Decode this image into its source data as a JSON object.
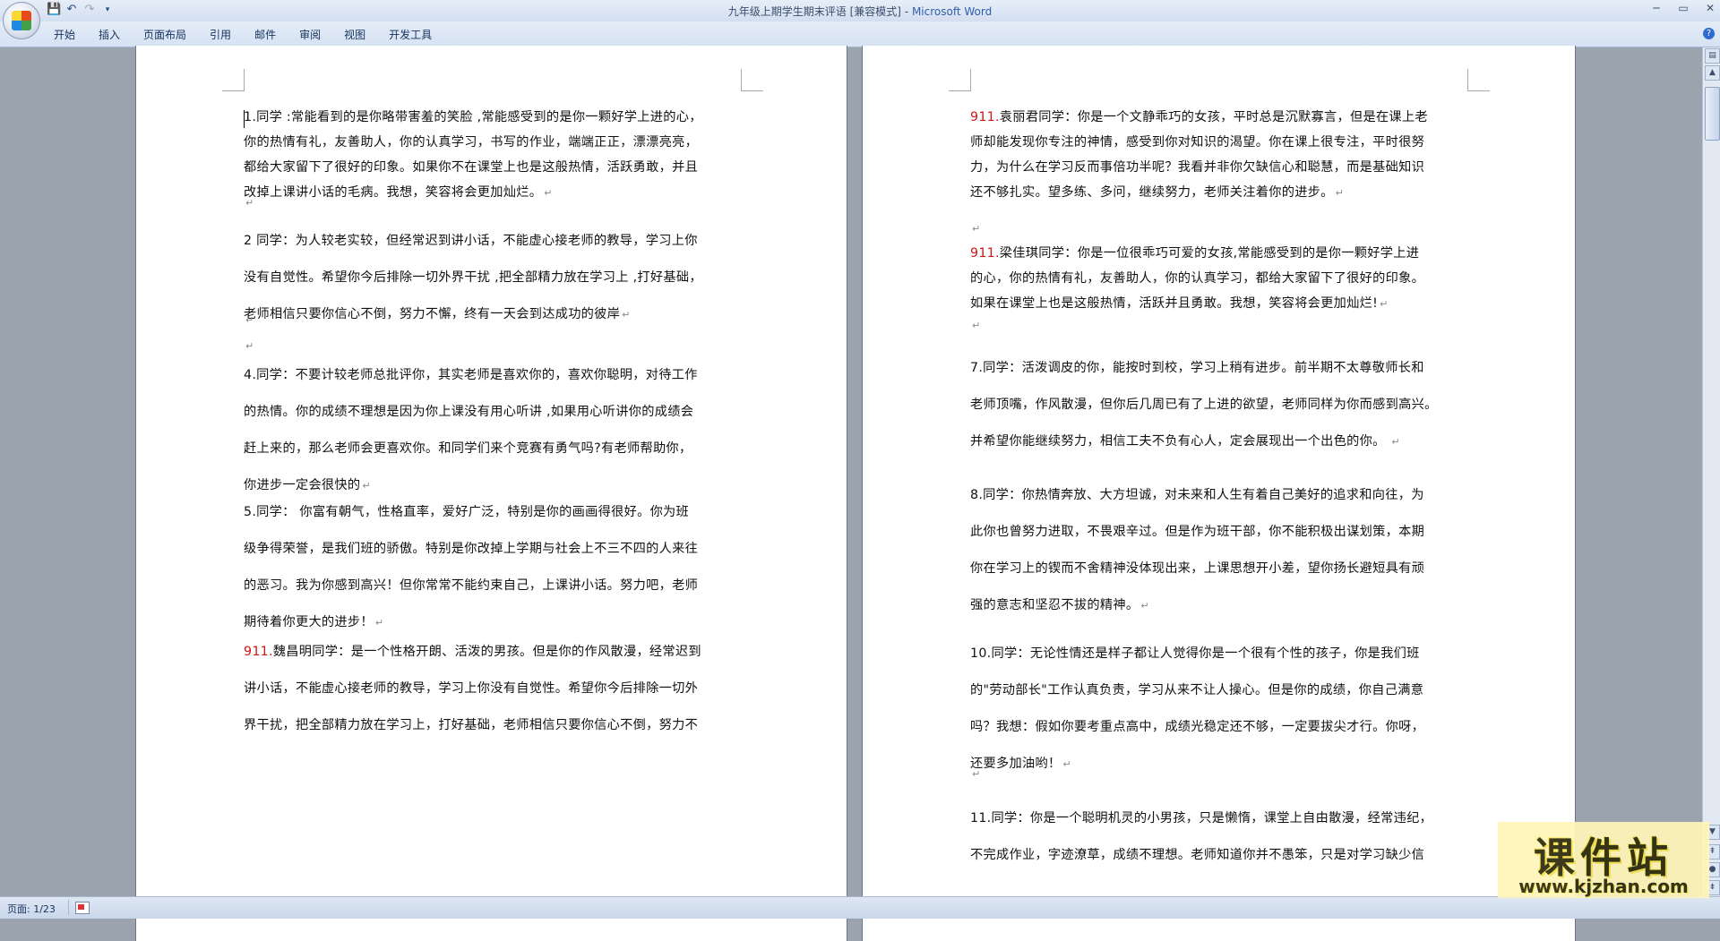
{
  "window": {
    "title_doc": "九年级上期学生期末评语 [兼容模式]",
    "title_sep": " - ",
    "title_app": "Microsoft Word"
  },
  "qat": {
    "save": "💾",
    "undo": "↶",
    "redo": "↷",
    "customize": "▾"
  },
  "ribbon": {
    "tabs": [
      "开始",
      "插入",
      "页面布局",
      "引用",
      "邮件",
      "审阅",
      "视图",
      "开发工具"
    ]
  },
  "status": {
    "page": "页面: 1/23"
  },
  "watermark": {
    "title": "课件站",
    "url": "www.kjzhan.com"
  },
  "page1": {
    "paragraphs": [
      {
        "lines": [
          "1.同学 :常能看到的是你略带害羞的笑脸 ,常能感受到的是你一颗好学上进的心，",
          "你的热情有礼，友善助人，你的认真学习，书写的作业，端端正正，漂漂亮亮，",
          "都给大家留下了很好的印象。如果你不在课堂上也是这般热情，活跃勇敢，并且",
          "改掉上课讲小话的毛病。我想，笑容将会更加灿烂。↵"
        ]
      },
      {
        "lines": [
          "↵"
        ]
      },
      {
        "lines": [
          "2 同学：为人较老实较，但经常迟到讲小话，不能虚心接老师的教导，学习上你",
          "没有自觉性。希望你今后排除一切外界干扰 ,把全部精力放在学习上 ,打好基础，",
          "老师相信只要你信心不倒，努力不懈，终有一天会到达成功的彼岸↵"
        ]
      },
      {
        "lines": [
          "↵"
        ]
      },
      {
        "lines": [
          "↵"
        ]
      },
      {
        "lines": [
          "4.同学：不要计较老师总批评你，其实老师是喜欢你的，喜欢你聪明，对待工作",
          "的热情。你的成绩不理想是因为你上课没有用心听讲 ,如果用心听讲你的成绩会",
          "赶上来的，那么老师会更喜欢你。和同学们来个竞赛有勇气吗?有老师帮助你，",
          "你进步一定会很快的↵"
        ]
      },
      {
        "lines": [
          "5.同学： 你富有朝气，性格直率，爱好广泛，特别是你的画画得很好。你为班",
          "级争得荣誉，是我们班的骄傲。特别是你改掉上学期与社会上不三不四的人来往",
          "的恶习。我为你感到高兴！但你常常不能约束自己，上课讲小话。努力吧，老师",
          "期待着你更大的进步！↵"
        ]
      },
      {
        "num": "911.",
        "lines": [
          "魏昌明同学：是一个性格开朗、活泼的男孩。但是你的作风散漫，经常迟到",
          "讲小话，不能虚心接老师的教导，学习上你没有自觉性。希望你今后排除一切外",
          "界干扰，把全部精力放在学习上，打好基础，老师相信只要你信心不倒，努力不"
        ]
      }
    ]
  },
  "page2": {
    "paragraphs": [
      {
        "num": "911.",
        "lines": [
          "袁丽君同学：你是一个文静乖巧的女孩，平时总是沉默寡言，但是在课上老",
          "师却能发现你专注的神情，感受到你对知识的渴望。你在课上很专注，平时很努",
          "力，为什么在学习反而事倍功半呢？我看并非你欠缺信心和聪慧，而是基础知识",
          "还不够扎实。望多练、多问，继续努力，老师关注着你的进步。↵"
        ]
      },
      {
        "lines": [
          "↵"
        ]
      },
      {
        "num": "911.",
        "lines": [
          "梁佳琪同学：你是一位很乖巧可爱的女孩,常能感受到的是你一颗好学上进",
          "的心，你的热情有礼，友善助人，你的认真学习，都给大家留下了很好的印象。",
          "如果在课堂上也是这般热情，活跃并且勇敢。我想，笑容将会更加灿烂!↵"
        ]
      },
      {
        "lines": [
          "↵"
        ]
      },
      {
        "lines": [
          "7.同学：活泼调皮的你，能按时到校，学习上稍有进步。前半期不太尊敬师长和",
          "老师顶嘴，作风散漫，但你后几周已有了上进的欲望，老师同样为你而感到高兴。",
          "并希望你能继续努力，相信工夫不负有心人，定会展现出一个出色的你。 ↵"
        ]
      },
      {
        "lines": [
          "8.同学：你热情奔放、大方坦诚，对未来和人生有着自己美好的追求和向往，为",
          "此你也曾努力进取，不畏艰辛过。但是作为班干部，你不能积极出谋划策，本期",
          "你在学习上的锲而不舍精神没体现出来，上课思想开小差，望你扬长避短具有顽",
          "强的意志和坚忍不拔的精神。↵"
        ]
      },
      {
        "lines": [
          "10.同学：无论性情还是样子都让人觉得你是一个很有个性的孩子，你是我们班",
          "的\"劳动部长\"工作认真负责，学习从来不让人操心。但是你的成绩，你自己满意",
          "吗？我想：假如你要考重点高中，成绩光稳定还不够，一定要拔尖才行。你呀，",
          "还要多加油哟！↵"
        ]
      },
      {
        "lines": [
          "↵"
        ]
      },
      {
        "lines": [
          "11.同学：你是一个聪明机灵的小男孩，只是懒惰，课堂上自由散漫，经常违纪，",
          "不完成作业，字迹潦草，成绩不理想。老师知道你并不愚笨，只是对学习缺少信"
        ]
      }
    ]
  }
}
